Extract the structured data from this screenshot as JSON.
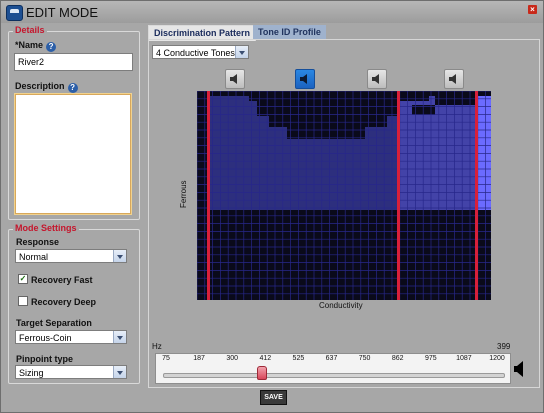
{
  "window": {
    "title": "EDIT MODE",
    "close_label": "×"
  },
  "details": {
    "legend": "Details",
    "name_label": "*Name",
    "name_value": "River2",
    "description_label": "Description",
    "description_value": ""
  },
  "mode_settings": {
    "legend": "Mode Settings",
    "response_label": "Response",
    "response_value": "Normal",
    "recovery_fast": {
      "label": "Recovery Fast",
      "checked": true,
      "mark": "✓"
    },
    "recovery_deep": {
      "label": "Recovery Deep",
      "checked": false,
      "mark": ""
    },
    "target_separation_label": "Target Separation",
    "target_separation_value": "Ferrous-Coin",
    "pinpoint_label": "Pinpoint type",
    "pinpoint_value": "Sizing"
  },
  "tabs": [
    {
      "label": "Discrimination Pattern",
      "active": true
    },
    {
      "label": "Tone ID Profile",
      "active": false
    }
  ],
  "pattern": {
    "tones_value": "4 Conductive Tones",
    "speakers": [
      {
        "icon": "speaker-icon",
        "active": false
      },
      {
        "icon": "speaker-icon",
        "active": true
      },
      {
        "icon": "speaker-icon",
        "active": false
      },
      {
        "icon": "speaker-icon",
        "active": false
      }
    ],
    "ylabel": "Ferrous",
    "xlabel": "Conductivity",
    "colors": {
      "tone1": "#2d2f7e",
      "tone2": "#33348a",
      "tone3": "#4343a8",
      "tone4": "#6b6bff",
      "grid_bg": "#0a0a1a",
      "grid_line": "#27278a",
      "divider": "#d8203a"
    }
  },
  "frequency": {
    "hz_label": "Hz",
    "value_label": "399",
    "ticks": [
      "75",
      "187",
      "300",
      "412",
      "525",
      "637",
      "750",
      "862",
      "975",
      "1087",
      "1200"
    ],
    "value": 399,
    "min": 75,
    "max": 1200
  },
  "save_label": "SAVE"
}
